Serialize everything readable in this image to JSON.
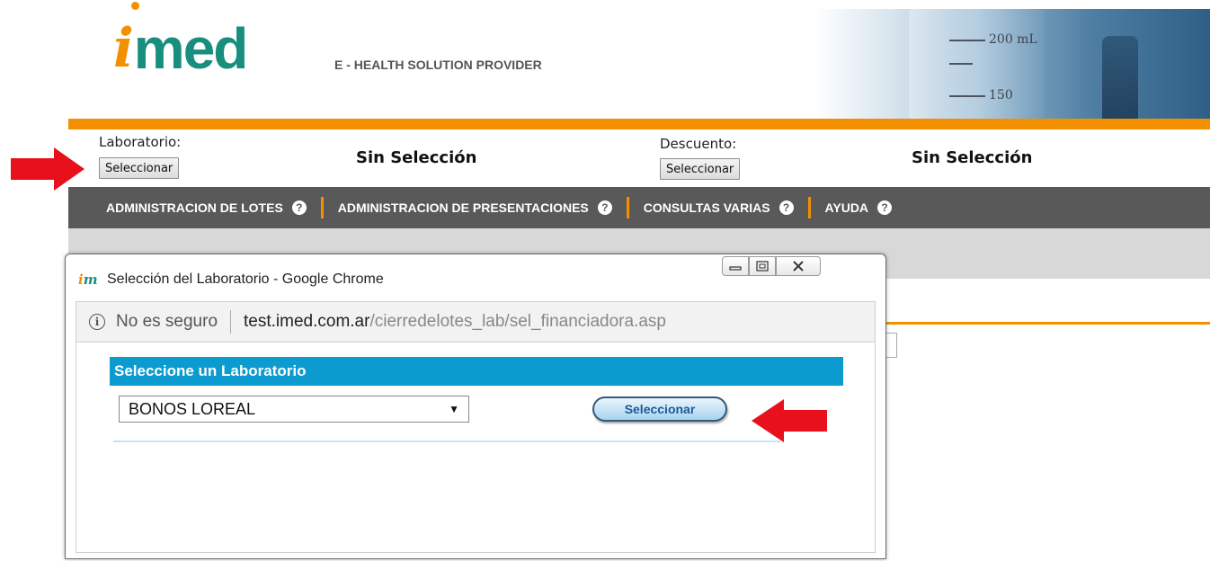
{
  "header": {
    "logo_i": "i",
    "logo_med": "med",
    "tagline": "E - HEALTH SOLUTION PROVIDER",
    "photo_marks": [
      "200 mL",
      "150"
    ],
    "brand_orange": "#f39000",
    "brand_teal": "#178e7e"
  },
  "selection": {
    "laboratorio_label": "Laboratorio:",
    "laboratorio_button": "Seleccionar",
    "laboratorio_value": "Sin Selección",
    "descuento_label": "Descuento:",
    "descuento_button": "Seleccionar",
    "descuento_value": "Sin Selección"
  },
  "menu": {
    "items": [
      {
        "label": "ADMINISTRACION DE LOTES",
        "icon": "help-icon"
      },
      {
        "label": "ADMINISTRACION DE PRESENTACIONES",
        "icon": "help-icon"
      },
      {
        "label": "CONSULTAS VARIAS",
        "icon": "help-icon"
      },
      {
        "label": "AYUDA",
        "icon": "help-icon"
      }
    ],
    "help_glyph": "?",
    "background": "#595959"
  },
  "popup": {
    "favicon_i": "i",
    "favicon_m": "m",
    "title": "Selección del Laboratorio - Google Chrome",
    "address": {
      "security_text": "No es seguro",
      "url_host": "test.imed.com.ar",
      "url_path": "/cierredelotes_lab/sel_financiadora.asp"
    },
    "content": {
      "header": "Seleccione un Laboratorio",
      "select_value": "BONOS LOREAL",
      "button": "Seleccionar",
      "header_color": "#0c9bcf"
    }
  },
  "annotations": {
    "arrow_color": "#e8101c"
  }
}
